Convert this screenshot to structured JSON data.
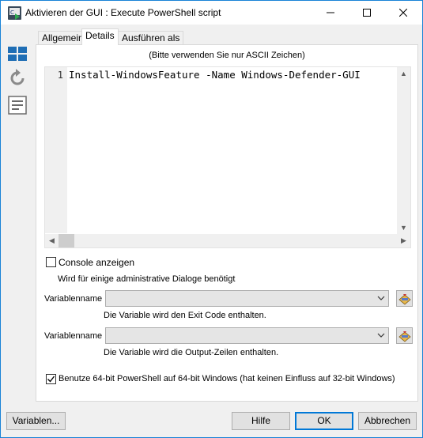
{
  "window": {
    "title": "Aktivieren der GUI : Execute PowerShell script"
  },
  "tabs": [
    {
      "label": "Allgemein"
    },
    {
      "label": "Details"
    },
    {
      "label": "Ausführen als"
    }
  ],
  "details": {
    "hint": "(Bitte verwenden Sie nur ASCII Zeichen)",
    "editor": {
      "line_number": "1",
      "code": "Install-WindowsFeature -Name Windows-Defender-GUI"
    },
    "console_checkbox": {
      "label": "Console anzeigen",
      "checked": false
    },
    "console_hint": "Wird für einige administrative Dialoge benötigt",
    "var_exit": {
      "label": "Variablenname",
      "value": "",
      "description": "Die Variable wird den Exit Code enthalten."
    },
    "var_output": {
      "label": "Variablenname",
      "value": "",
      "description": "Die Variable wird die Output-Zeilen enthalten."
    },
    "ps64_checkbox": {
      "label": "Benutze 64-bit PowerShell auf 64-bit Windows (hat keinen Einfluss auf 32-bit Windows)",
      "checked": true
    }
  },
  "footer": {
    "variables_button": "Variablen...",
    "help_button": "Hilfe",
    "ok_button": "OK",
    "cancel_button": "Abbrechen"
  },
  "colors": {
    "accent": "#0078d7",
    "icon_blue": "#1f6eb5"
  }
}
